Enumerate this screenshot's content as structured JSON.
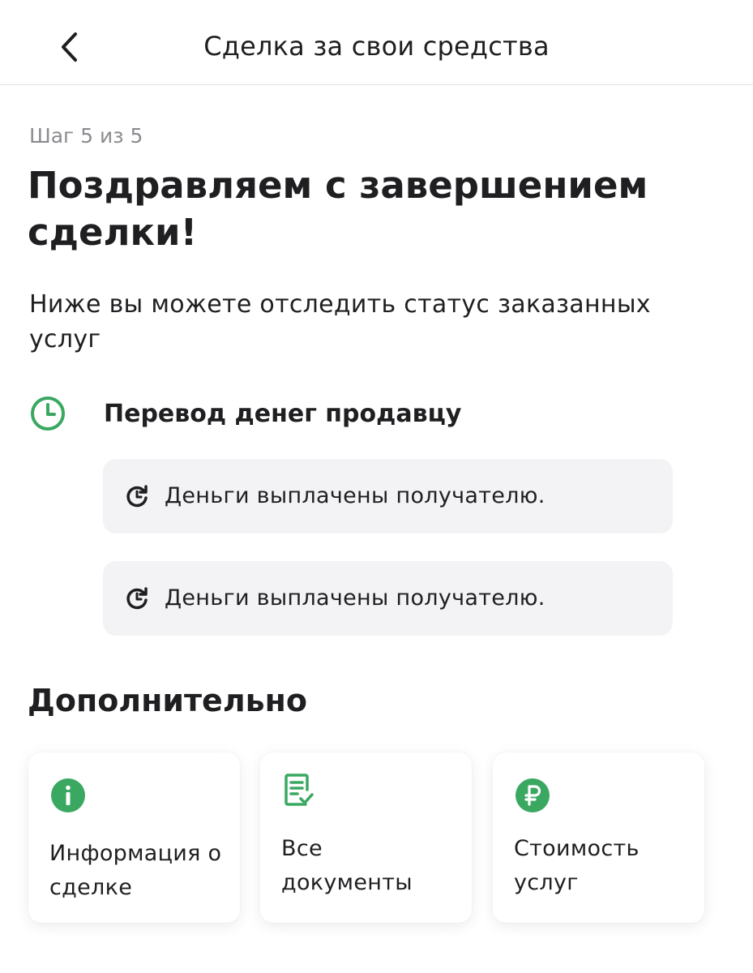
{
  "header": {
    "title": "Сделка за свои средства"
  },
  "step": "Шаг 5 из 5",
  "headline": "Поздравляем с завершением сделки!",
  "subtitle": "Ниже вы можете отследить статус заказанных услуг",
  "transfer": {
    "title": "Перевод денег продавцу",
    "icon": "clock-icon",
    "items": [
      {
        "icon": "refresh-icon",
        "text": "Деньги выплачены получателю."
      },
      {
        "icon": "refresh-icon",
        "text": "Деньги выплачены получателю."
      }
    ]
  },
  "additional": {
    "title": "Дополнительно",
    "tiles": [
      {
        "icon": "info-icon",
        "label": "Информация о сделке"
      },
      {
        "icon": "document-check-icon",
        "label": "Все документы"
      },
      {
        "icon": "ruble-icon",
        "label": "Стоимость услуг"
      }
    ]
  },
  "colors": {
    "accent": "#3aa861",
    "text": "#1f1f22",
    "muted": "#8b8b90",
    "card_bg": "#f3f3f5"
  }
}
